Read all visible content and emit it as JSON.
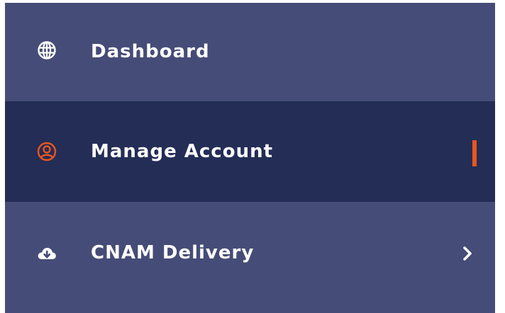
{
  "sidebar": {
    "items": [
      {
        "label": "Dashboard",
        "icon": "globe-icon",
        "active": false
      },
      {
        "label": "Manage Account",
        "icon": "user-circle-icon",
        "active": true
      },
      {
        "label": "CNAM Delivery",
        "icon": "cloud-download-icon",
        "active": false,
        "has_submenu": true
      }
    ]
  },
  "colors": {
    "sidebar_bg": "#454c77",
    "active_bg": "#242d55",
    "accent": "#e8561f",
    "text": "#ffffff"
  }
}
